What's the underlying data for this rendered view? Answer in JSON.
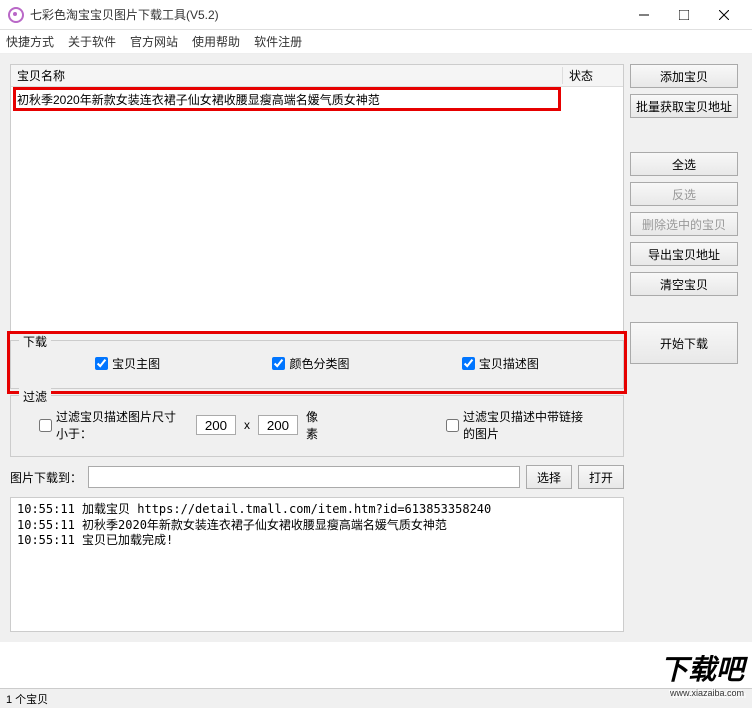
{
  "window": {
    "title": "七彩色淘宝宝贝图片下载工具(V5.2)"
  },
  "menu": {
    "items": [
      "快捷方式",
      "关于软件",
      "官方网站",
      "使用帮助",
      "软件注册"
    ]
  },
  "table": {
    "header_name": "宝贝名称",
    "header_status": "状态",
    "rows": [
      {
        "name": "初秋季2020年新款女装连衣裙子仙女裙收腰显瘦高端名媛气质女神范"
      }
    ]
  },
  "download": {
    "legend": "下载",
    "chk_main": "宝贝主图",
    "chk_color": "颜色分类图",
    "chk_desc": "宝贝描述图"
  },
  "filter": {
    "legend": "过滤",
    "chk_size_label": "过滤宝贝描述图片尺寸小于：",
    "w": "200",
    "x": "x",
    "h": "200",
    "px": "像素",
    "chk_link_label": "过滤宝贝描述中带链接的图片"
  },
  "path": {
    "label": "图片下载到：",
    "value": "",
    "browse": "选择",
    "open": "打开"
  },
  "buttons": {
    "add": "添加宝贝",
    "batch": "批量获取宝贝地址",
    "select_all": "全选",
    "invert": "反选",
    "delete_sel": "删除选中的宝贝",
    "export": "导出宝贝地址",
    "clear": "清空宝贝",
    "start": "开始下载"
  },
  "log": {
    "lines": [
      "10:55:11  加载宝贝 https://detail.tmall.com/item.htm?id=613853358240",
      "10:55:11  初秋季2020年新款女装连衣裙子仙女裙收腰显瘦高端名媛气质女神范",
      "10:55:11  宝贝已加载完成!"
    ]
  },
  "status": {
    "count": "1 个宝贝"
  },
  "watermark": {
    "main": "下载吧",
    "sub": "www.xiazaiba.com"
  }
}
